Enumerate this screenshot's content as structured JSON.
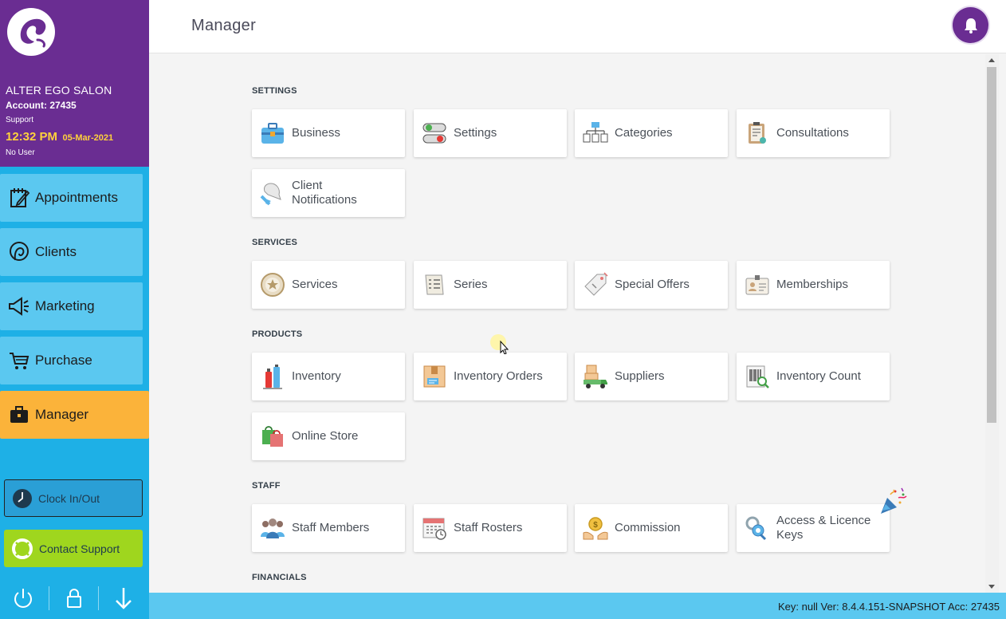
{
  "sidebar": {
    "salon_name": "ALTER EGO SALON",
    "account": "Account: 27435",
    "support": "Support",
    "time": "12:32 PM",
    "date": "05-Mar-2021",
    "user": "No User",
    "nav": [
      {
        "label": "Appointments",
        "icon": "notepad-icon"
      },
      {
        "label": "Clients",
        "icon": "head-icon"
      },
      {
        "label": "Marketing",
        "icon": "megaphone-icon"
      },
      {
        "label": "Purchase",
        "icon": "cart-icon"
      },
      {
        "label": "Manager",
        "icon": "briefcase-icon"
      }
    ],
    "clock_in_out": "Clock In/Out",
    "contact_support": "Contact Support"
  },
  "header": {
    "title": "Manager"
  },
  "sections": {
    "settings": {
      "title": "SETTINGS",
      "cards": [
        "Business",
        "Settings",
        "Categories",
        "Consultations",
        "Client Notifications"
      ]
    },
    "services": {
      "title": "SERVICES",
      "cards": [
        "Services",
        "Series",
        "Special Offers",
        "Memberships"
      ]
    },
    "products": {
      "title": "PRODUCTS",
      "cards": [
        "Inventory",
        "Inventory Orders",
        "Suppliers",
        "Inventory Count",
        "Online Store"
      ]
    },
    "staff": {
      "title": "STAFF",
      "cards": [
        "Staff Members",
        "Staff Rosters",
        "Commission",
        "Access & Licence Keys"
      ]
    },
    "financials": {
      "title": "FINANCIALS"
    }
  },
  "footer": {
    "version": "Key: null Ver: 8.4.4.151-SNAPSHOT Acc: 27435"
  },
  "colors": {
    "brand_purple": "#6a2d92",
    "sidebar_blue": "#1eb0e6",
    "nav_light_blue": "#5bc8f0",
    "active_orange": "#fbb33a",
    "support_green": "#9fd61e",
    "clock_yellow": "#ffd23c"
  }
}
